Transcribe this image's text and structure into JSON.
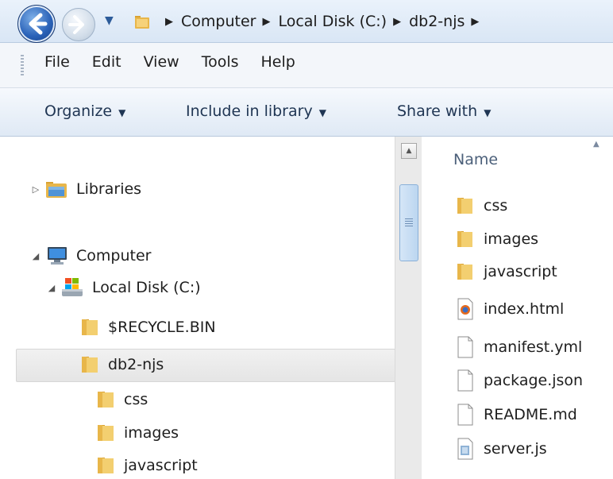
{
  "breadcrumb": [
    "Computer",
    "Local Disk (C:)",
    "db2-njs"
  ],
  "menu": [
    "File",
    "Edit",
    "View",
    "Tools",
    "Help"
  ],
  "commands": [
    {
      "label": "Organize"
    },
    {
      "label": "Include in library"
    },
    {
      "label": "Share with"
    }
  ],
  "nav_tree": {
    "libraries": "Libraries",
    "computer": "Computer",
    "local_disk": "Local Disk (C:)",
    "recycle": "$RECYCLE.BIN",
    "db2njs": "db2-njs",
    "css": "css",
    "images": "images",
    "javascript": "javascript"
  },
  "file_list": {
    "column_name": "Name",
    "files": [
      {
        "name": "css",
        "icon": "folder-icon"
      },
      {
        "name": "images",
        "icon": "folder-icon"
      },
      {
        "name": "javascript",
        "icon": "folder-icon"
      },
      {
        "name": "index.html",
        "icon": "html-file-icon"
      },
      {
        "name": "manifest.yml",
        "icon": "file-icon"
      },
      {
        "name": "package.json",
        "icon": "file-icon"
      },
      {
        "name": "README.md",
        "icon": "file-icon"
      },
      {
        "name": "server.js",
        "icon": "script-file-icon"
      }
    ]
  },
  "colors": {
    "accent": "#2a62b8",
    "selection": "#e9e9e9",
    "folder": "#e8b64a"
  }
}
